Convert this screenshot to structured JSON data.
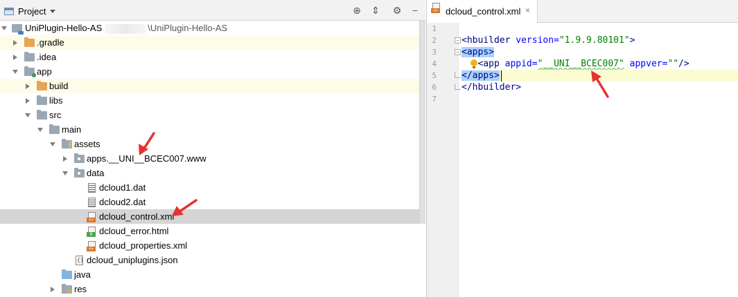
{
  "project_panel": {
    "title": "Project",
    "toolbar_icons": [
      "locate-icon",
      "collapse-icon",
      "gear-icon",
      "hide-icon"
    ],
    "tree": [
      {
        "label": "UniPlugin-Hello-AS",
        "suffix": "\\UniPlugin-Hello-AS",
        "icon": "module-icon",
        "level": 0,
        "expanded": true
      },
      {
        "label": ".gradle",
        "icon": "folder-orange-icon",
        "level": 1,
        "expanded": false
      },
      {
        "label": ".idea",
        "icon": "folder-icon",
        "level": 1,
        "expanded": false
      },
      {
        "label": "app",
        "icon": "app-module-icon",
        "level": 1,
        "expanded": true
      },
      {
        "label": "build",
        "icon": "folder-orange-icon",
        "level": 2,
        "expanded": false
      },
      {
        "label": "libs",
        "icon": "folder-icon",
        "level": 2,
        "expanded": false
      },
      {
        "label": "src",
        "icon": "folder-icon",
        "level": 2,
        "expanded": true
      },
      {
        "label": "main",
        "icon": "folder-icon",
        "level": 3,
        "expanded": true
      },
      {
        "label": "assets",
        "icon": "assets-folder-icon",
        "level": 4,
        "expanded": true
      },
      {
        "label": "apps.__UNI__BCEC007.www",
        "icon": "folder-icon",
        "level": 5,
        "expanded": false
      },
      {
        "label": "data",
        "icon": "folder-icon",
        "level": 5,
        "expanded": true
      },
      {
        "label": "dcloud1.dat",
        "icon": "dat-file-icon",
        "level": 6
      },
      {
        "label": "dcloud2.dat",
        "icon": "dat-file-icon",
        "level": 6
      },
      {
        "label": "dcloud_control.xml",
        "icon": "xml-file-icon",
        "level": 6,
        "selected": true
      },
      {
        "label": "dcloud_error.html",
        "icon": "html-file-icon",
        "level": 6
      },
      {
        "label": "dcloud_properties.xml",
        "icon": "xml-file-icon",
        "level": 6
      },
      {
        "label": "dcloud_uniplugins.json",
        "icon": "json-file-icon",
        "level": 5
      },
      {
        "label": "java",
        "icon": "folder-blue-icon",
        "level": 4
      },
      {
        "label": "res",
        "icon": "res-folder-icon",
        "level": 4,
        "expanded": false
      }
    ]
  },
  "editor": {
    "tab": {
      "label": "dcloud_control.xml",
      "close": "×"
    },
    "line_numbers": [
      "1",
      "2",
      "3",
      "4",
      "5",
      "6",
      "7"
    ],
    "lines": {
      "l2": {
        "open": "<hbuilder",
        "attr": "version=",
        "val": "\"1.9.9.80101\"",
        "close": ">"
      },
      "l3": {
        "tag": "<apps>"
      },
      "l4": {
        "open": "<app",
        "attr1": "appid=",
        "val1": "\"__UNI__BCEC007\"",
        "attr2": "appver=",
        "val2": "\"\"",
        "close": "/>"
      },
      "l5": {
        "tag": "</apps>"
      },
      "l6": {
        "tag": "</hbuilder>"
      }
    }
  },
  "colors": {
    "annotation_arrow": "#e8322f",
    "selection": "#d5d5d5",
    "xml_tag": "#000080",
    "xml_attr": "#0000ff",
    "xml_value": "#008000"
  }
}
